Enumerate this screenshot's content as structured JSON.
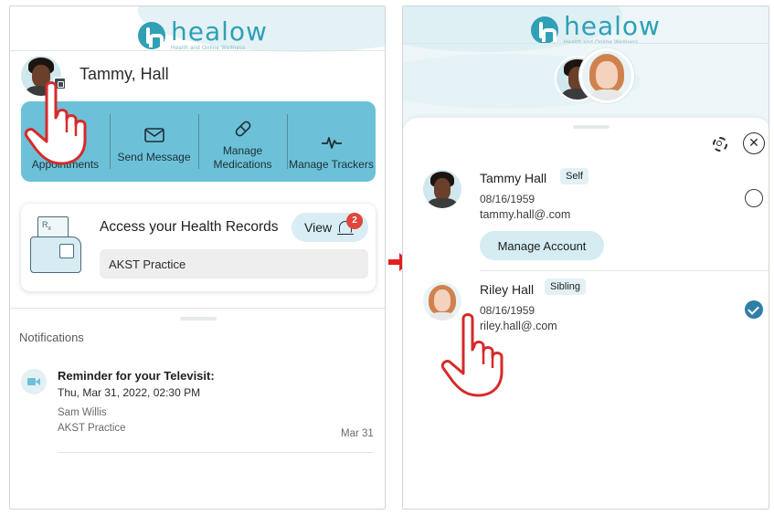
{
  "brand": {
    "name": "healow",
    "tagline": "Health and Online Wellness",
    "color": "#2fa0b6"
  },
  "home": {
    "user_name": "Tammy, Hall",
    "quick_actions": [
      {
        "label": "Appointments",
        "icon": "calendar-icon"
      },
      {
        "label": "Send Message",
        "icon": "envelope-icon"
      },
      {
        "label": "Manage Medications",
        "icon": "pill-icon"
      },
      {
        "label": "Manage Trackers",
        "icon": "heartbeat-icon"
      }
    ],
    "records": {
      "title": "Access your Health Records",
      "view_label": "View",
      "notification_count": "2",
      "practice": "AKST Practice"
    },
    "notifications": {
      "title": "Notifications",
      "items": [
        {
          "heading": "Reminder for your Televisit:",
          "time": "Thu, Mar 31, 2022, 02:30 PM",
          "person": "Sam Willis",
          "practice": "AKST Practice",
          "date": "Mar 31"
        }
      ]
    }
  },
  "switcher": {
    "accounts": [
      {
        "name": "Tammy Hall",
        "relation": "Self",
        "dob": "08/16/1959",
        "email": "tammy.hall@.com",
        "manage_label": "Manage Account",
        "selected": false
      },
      {
        "name": "Riley Hall",
        "relation": "Sibling",
        "dob": "08/16/1959",
        "email": "riley.hall@.com",
        "selected": true
      }
    ]
  },
  "colors": {
    "quick_actions_bg": "#6cc1d8",
    "badge_red": "#e0463b",
    "arrow_red": "#e02020",
    "selected_check": "#2f7fa7"
  }
}
